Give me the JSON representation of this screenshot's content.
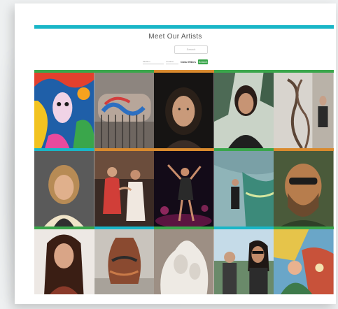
{
  "page": {
    "title": "Meet Our Artists"
  },
  "search": {
    "placeholder": "Search"
  },
  "filters": {
    "medium": "Medium",
    "location": "Location",
    "link": "Clear filters",
    "button": "Search"
  },
  "colors": {
    "accent": "#19b6c7",
    "go": "#3aa64b",
    "green": "#3aa64b",
    "orange": "#d98a2e",
    "teal": "#19b6c7"
  },
  "artists": [
    {
      "tile": "abstract-face-painting",
      "border": "#3aa64b"
    },
    {
      "tile": "graffiti-mural-photo",
      "border": "#3aa64b"
    },
    {
      "tile": "portrait-woman-dark-hair",
      "border": "#d98a2e"
    },
    {
      "tile": "portrait-woman-smiling",
      "border": "#3aa64b"
    },
    {
      "tile": "metal-sculpture-figure",
      "border": "#3aa64b"
    },
    {
      "tile": "portrait-woman-blonde",
      "border": "#19b6c7"
    },
    {
      "tile": "dancers-photo",
      "border": "#d98a2e"
    },
    {
      "tile": "dancer-stage-photo",
      "border": "#d98a2e"
    },
    {
      "tile": "woman-with-glass-art",
      "border": "#3aa64b"
    },
    {
      "tile": "bearded-man-painting",
      "border": "#d98a2e"
    },
    {
      "tile": "portrait-woman-long-hair",
      "border": "#3aa64b"
    },
    {
      "tile": "raku-vase-photo",
      "border": "#19b6c7"
    },
    {
      "tile": "stone-sculpture-photo",
      "border": "#3aa64b"
    },
    {
      "tile": "couple-outdoors-photo",
      "border": "#19b6c7"
    },
    {
      "tile": "colorful-mural-painting",
      "border": "#3aa64b"
    }
  ]
}
